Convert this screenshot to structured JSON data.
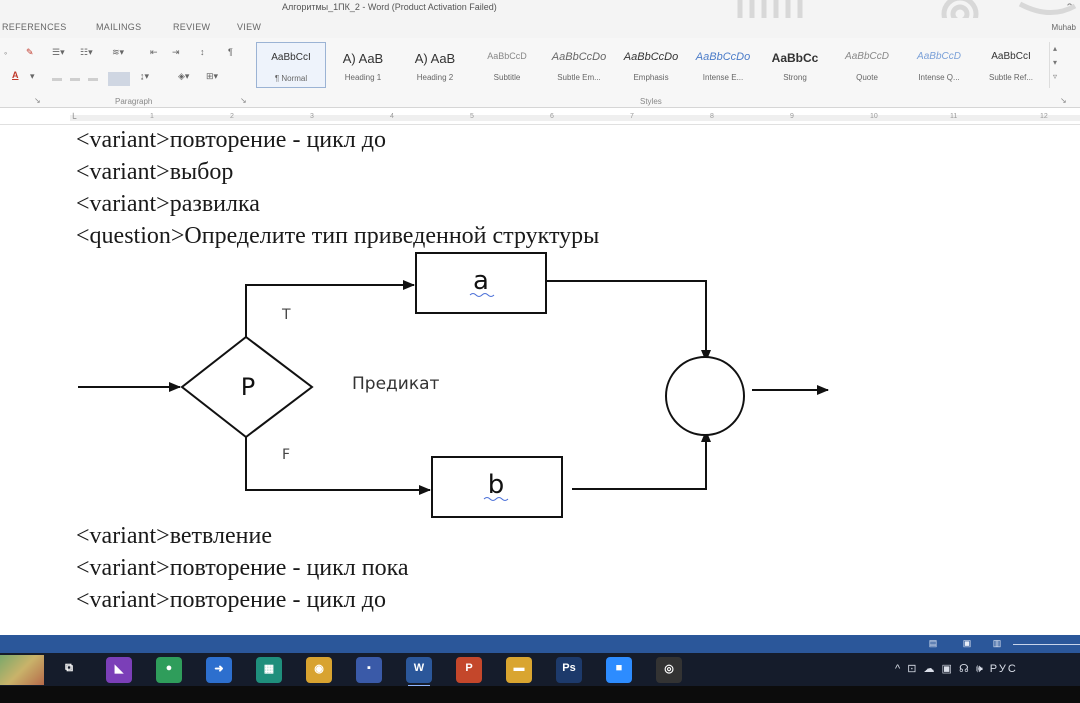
{
  "window": {
    "title": "Алгоритмы_1ПК_2 - Word (Product Activation Failed)",
    "help_label": "?",
    "user_label": "Muhab"
  },
  "ribbon_tabs": [
    "REFERENCES",
    "MAILINGS",
    "REVIEW",
    "VIEW"
  ],
  "ribbon": {
    "paragraph_group_label": "Paragraph",
    "styles_group_label": "Styles",
    "styles": [
      {
        "sample": "AaBbCcI",
        "name": "¶ Normal",
        "selected": true
      },
      {
        "sample": "A) AaB",
        "name": "Heading 1",
        "selected": false
      },
      {
        "sample": "A) AaB",
        "name": "Heading 2",
        "selected": false
      },
      {
        "sample": "AaBbCcD",
        "name": "Subtitle",
        "selected": false
      },
      {
        "sample": "AaBbCcDo",
        "name": "Subtle Em...",
        "selected": false
      },
      {
        "sample": "AaBbCcDo",
        "name": "Emphasis",
        "selected": false
      },
      {
        "sample": "AaBbCcDo",
        "name": "Intense E...",
        "selected": false
      },
      {
        "sample": "AaBbCc",
        "name": "Strong",
        "selected": false
      },
      {
        "sample": "AaBbCcD",
        "name": "Quote",
        "selected": false
      },
      {
        "sample": "AaBbCcD",
        "name": "Intense Q...",
        "selected": false
      },
      {
        "sample": "AaBbCcI",
        "name": "Subtle Ref...",
        "selected": false
      }
    ]
  },
  "ruler": {
    "marks": [
      "1",
      "2",
      "3",
      "4",
      "5",
      "6",
      "7",
      "8",
      "9",
      "10",
      "11",
      "12"
    ]
  },
  "document": {
    "lines_before": [
      "<variant>повторение - цикл до",
      "<variant>выбор",
      "<variant>развилка",
      "<question>Определите тип приведенной структуры"
    ],
    "flowchart": {
      "predicate_symbol": "P",
      "predicate_label": "Предикат",
      "true_label": "Т",
      "false_label": "F",
      "box_top_label": "a",
      "box_bottom_label": "b"
    },
    "lines_after": [
      "<variant>ветвление",
      "<variant>повторение - цикл пока",
      "<variant>повторение - цикл до"
    ]
  },
  "taskbar": {
    "apps": [
      {
        "name": "task-view",
        "glyph": "⧉",
        "color": "#151c2b"
      },
      {
        "name": "visual-studio",
        "glyph": "◣",
        "color": "#7b3fb8"
      },
      {
        "name": "xbox",
        "glyph": "●",
        "color": "#2f9d5b"
      },
      {
        "name": "file-manager-arrow",
        "glyph": "➜",
        "color": "#2d6fce"
      },
      {
        "name": "calculator",
        "glyph": "▦",
        "color": "#1f8f7c"
      },
      {
        "name": "chrome",
        "glyph": "◉",
        "color": "#d8a330"
      },
      {
        "name": "save-disk",
        "glyph": "▪",
        "color": "#3a5aa8"
      },
      {
        "name": "word",
        "glyph": "W",
        "color": "#2b579a"
      },
      {
        "name": "powerpoint",
        "glyph": "P",
        "color": "#c4472b"
      },
      {
        "name": "file-explorer",
        "glyph": "▬",
        "color": "#d9a530"
      },
      {
        "name": "photoshop",
        "glyph": "Ps",
        "color": "#1d3a6b"
      },
      {
        "name": "zoom",
        "glyph": "■",
        "color": "#2d8cff"
      },
      {
        "name": "obs",
        "glyph": "◎",
        "color": "#333333"
      }
    ],
    "tray_text": "^ ⊡ ☁ ▣ ☊ 🕪 РУС"
  }
}
